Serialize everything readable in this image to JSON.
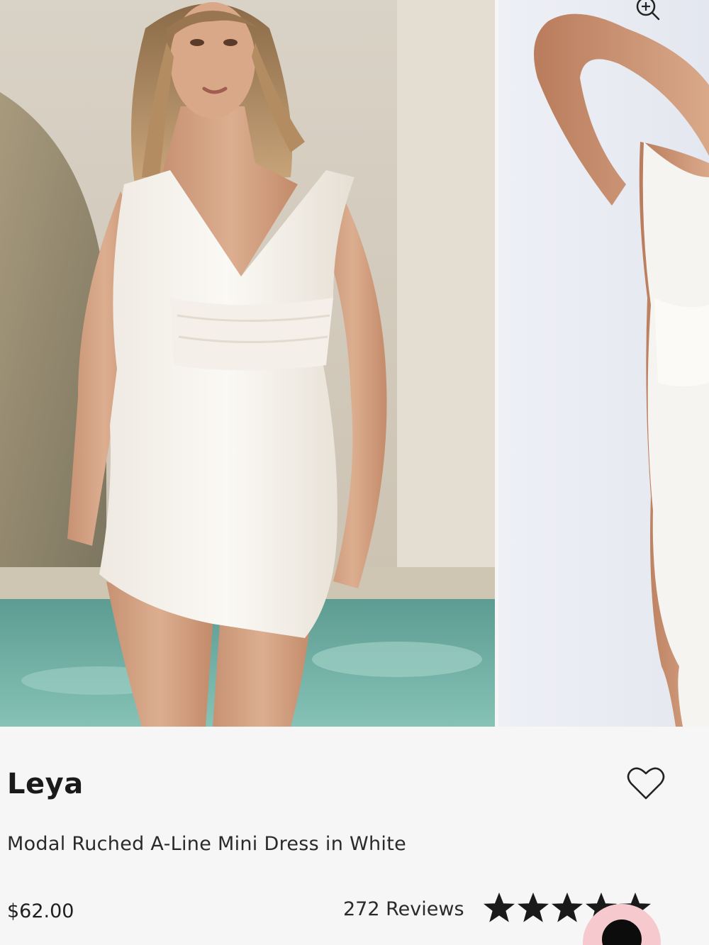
{
  "product": {
    "brand": "Leya",
    "name": "Modal Ruched A-Line Mini Dress in White",
    "price": "$62.00",
    "reviews_label": "272 Reviews",
    "rating": 5,
    "rating_max": 5
  },
  "gallery": {
    "slides": [
      "model-front-photo",
      "model-back-photo"
    ],
    "zoom_icon": "zoom-in-icon"
  },
  "icons": {
    "wishlist": "heart-outline-icon",
    "star": "star-icon",
    "chat": "chat-bubble-icon"
  },
  "colors": {
    "background": "#f7f6f6",
    "text": "#1f1f1f",
    "star": "#1a1a1a",
    "chat_fab": "#f6c9cf"
  }
}
